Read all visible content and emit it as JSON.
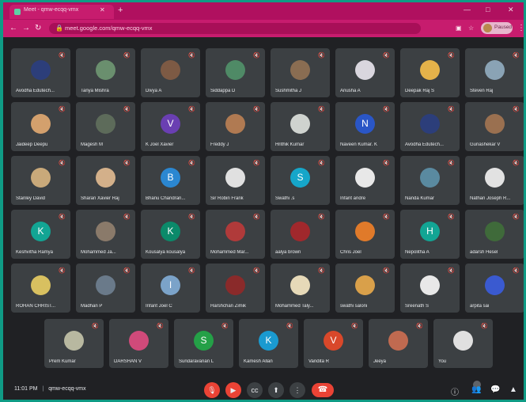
{
  "browser": {
    "tab_title": "Meet - qmw-ecqq-vmx",
    "url": "meet.google.com/qmw-ecqq-vmx",
    "profile_label": "Paused",
    "accent": "#c71c6e"
  },
  "meeting": {
    "time": "11:01 PM",
    "separator": "|",
    "code": "qmw-ecqq-vmx"
  },
  "participants": [
    {
      "name": "Avodha Edutech...",
      "avatar": "photo",
      "color": "#2c3e7a"
    },
    {
      "name": "Tanya Mishra",
      "avatar": "photo",
      "color": "#6a8f6e"
    },
    {
      "name": "Divya A",
      "avatar": "photo",
      "color": "#7d5a44"
    },
    {
      "name": "Siddappa D",
      "avatar": "photo",
      "color": "#4f8a66"
    },
    {
      "name": "Sushmitha J",
      "avatar": "photo",
      "color": "#8a6d52"
    },
    {
      "name": "Anusha A",
      "avatar": "photo",
      "color": "#d9d6de"
    },
    {
      "name": "Deepak Raj S",
      "avatar": "photo",
      "color": "#e4b24a"
    },
    {
      "name": "Steven Raj",
      "avatar": "photo",
      "color": "#8aa3b5"
    },
    {
      "name": "Jaideep Deepu",
      "avatar": "photo",
      "color": "#d3a06d"
    },
    {
      "name": "Magesh M",
      "avatar": "photo",
      "color": "#5d6b5a"
    },
    {
      "name": "K Joel Xavier",
      "avatar": "V",
      "color": "#6a3fb2"
    },
    {
      "name": "Freddy J",
      "avatar": "photo",
      "color": "#b07a52"
    },
    {
      "name": "Hrithik Kumar",
      "avatar": "photo",
      "color": "#cfd3cf"
    },
    {
      "name": "Naveen Kumar. K",
      "avatar": "N",
      "color": "#2a56c6"
    },
    {
      "name": "Avodha Edutech...",
      "avatar": "photo",
      "color": "#2c3e7a"
    },
    {
      "name": "Gunashekar V",
      "avatar": "photo",
      "color": "#9a7050"
    },
    {
      "name": "Stanley David",
      "avatar": "photo",
      "color": "#c9a97a"
    },
    {
      "name": "Sharan Xavier Raj",
      "avatar": "photo",
      "color": "#d3b08a"
    },
    {
      "name": "Bhanu Chandran...",
      "avatar": "B",
      "color": "#2b87d1"
    },
    {
      "name": "Sir Robin Frank",
      "avatar": "photo",
      "color": "#e0e0e0"
    },
    {
      "name": "Swathi .s",
      "avatar": "S",
      "color": "#16a6c9"
    },
    {
      "name": "Infant andre",
      "avatar": "photo",
      "color": "#e8e8e8"
    },
    {
      "name": "Nanda Kumar",
      "avatar": "photo",
      "color": "#5a8aa0"
    },
    {
      "name": "Nathan Joseph R...",
      "avatar": "photo",
      "color": "#e2e2e2"
    },
    {
      "name": "Keshvitha Ramya",
      "avatar": "K",
      "color": "#12a594"
    },
    {
      "name": "Mohammed Ja...",
      "avatar": "photo",
      "color": "#8a7a6a"
    },
    {
      "name": "Kousalya kousalya",
      "avatar": "K",
      "color": "#0b8a6a"
    },
    {
      "name": "Mohammed Mar...",
      "avatar": "photo",
      "color": "#b03a3a"
    },
    {
      "name": "aalya brown",
      "avatar": "photo",
      "color": "#a0282c"
    },
    {
      "name": "Chris Joel",
      "avatar": "photo",
      "color": "#e07a2a"
    },
    {
      "name": "Nepolitha A",
      "avatar": "H",
      "color": "#12a594"
    },
    {
      "name": "adarsh Hesel",
      "avatar": "photo",
      "color": "#3f6a3a"
    },
    {
      "name": "ROHAN CHRIST...",
      "avatar": "photo",
      "color": "#d8c060"
    },
    {
      "name": "Madhan P",
      "avatar": "photo",
      "color": "#6a7a8a"
    },
    {
      "name": "Infant Joel C",
      "avatar": "I",
      "color": "#7ba3c9"
    },
    {
      "name": "Harshchan Zimik",
      "avatar": "photo",
      "color": "#8a2a2a"
    },
    {
      "name": "Mohammed Taly...",
      "avatar": "photo",
      "color": "#e6d9b8"
    },
    {
      "name": "swathi saloni",
      "avatar": "photo",
      "color": "#d9a04a"
    },
    {
      "name": "Sreenath S",
      "avatar": "photo",
      "color": "#e8e8e8"
    },
    {
      "name": "arpita sai",
      "avatar": "photo",
      "color": "#3a5ad0"
    },
    {
      "name": "Prem Kumar",
      "avatar": "photo",
      "color": "#b8b8a0"
    },
    {
      "name": "DARSHAN V",
      "avatar": "photo",
      "color": "#d04a7a"
    },
    {
      "name": "Sundaravanan L",
      "avatar": "S",
      "color": "#24a047"
    },
    {
      "name": "Kamesh Allan",
      "avatar": "K",
      "color": "#1a9ad0"
    },
    {
      "name": "Vandita R",
      "avatar": "V",
      "color": "#d9482a"
    },
    {
      "name": "Jeeya",
      "avatar": "photo",
      "color": "#c06a50"
    },
    {
      "name": "You",
      "avatar": "photo",
      "color": "#e0e0e0"
    }
  ],
  "controls": {
    "mic_icon": "mic-off-icon",
    "cam_icon": "camera-off-icon",
    "captions_icon": "captions-icon",
    "present_icon": "present-icon",
    "more_icon": "more-vert-icon",
    "end_icon": "end-call-icon"
  }
}
